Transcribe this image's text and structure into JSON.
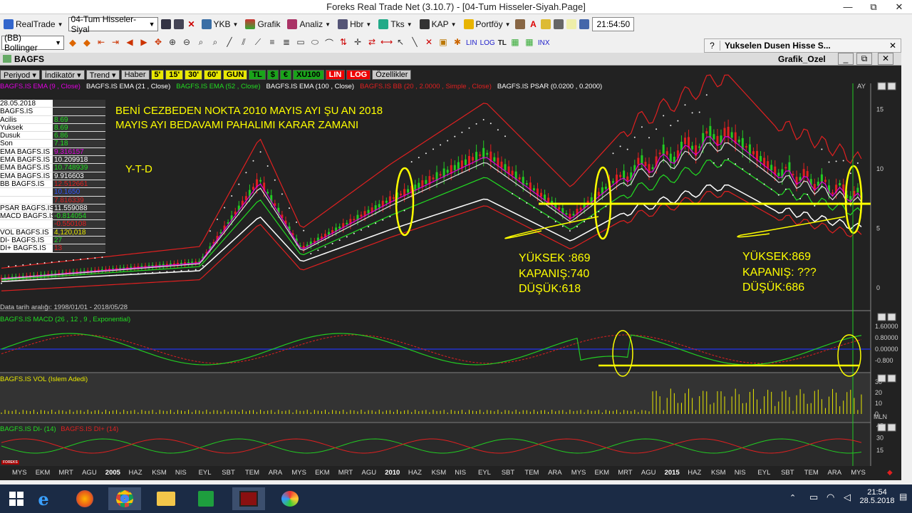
{
  "window": {
    "title": "Foreks Real Trade Net (3.10.7) - [04-Tum Hisseler-Siyah.Page]",
    "restore": "⧉",
    "close": "✕",
    "minimize": "—"
  },
  "toolbar1": {
    "realtrade": "RealTrade",
    "page_select": "04-Tum Hisseler-Siyal",
    "ykb": "YKB",
    "grafik": "Grafik",
    "analiz": "Analiz",
    "hbr": "Hbr",
    "tks": "Tks",
    "kap": "KAP",
    "portfoy": "Portföy",
    "clock": "21:54:50"
  },
  "toolbar2": {
    "indicator_select": "(BB) Bollinger",
    "lin": "LIN",
    "log": "LOG",
    "tl": "TL",
    "inx": "INX"
  },
  "panel": {
    "help": "?",
    "title": "Yukselen Dusen Hisse S..."
  },
  "chart_window": {
    "symbol": "BAGFS",
    "name": "Grafik_Ozel"
  },
  "chart_buttons": [
    "Periyod",
    "İndikatör",
    "Trend",
    "Haber",
    "5'",
    "15'",
    "30'",
    "60'",
    "GUN",
    "TL",
    "$",
    "€",
    "XU100",
    "LIN",
    "LOG",
    "Özellikler"
  ],
  "legend": [
    {
      "text": "BAGFS.IS EMA (9 , Close)",
      "color": "#e000e0"
    },
    {
      "text": "BAGFS.IS EMA (21 , Close)",
      "color": "#ffffff"
    },
    {
      "text": "BAGFS.IS EMA (52 , Close)",
      "color": "#22dd22"
    },
    {
      "text": "BAGFS.IS EMA (100 , Close)",
      "color": "#ffffff"
    },
    {
      "text": "BAGFS.IS BB (20 , 2.0000 , Simple , Close)",
      "color": "#e02020"
    },
    {
      "text": "BAGFS.IS PSAR (0.0200 , 0.2000)",
      "color": "#ffffff"
    }
  ],
  "ay_label": "AY",
  "info_table": [
    {
      "k": "28.05.2018",
      "v": "",
      "c": "#000"
    },
    {
      "k": "BAGFS.IS",
      "v": "",
      "c": "#000"
    },
    {
      "k": "Acilis",
      "v": "8.69",
      "c": "#22dd22"
    },
    {
      "k": "Yuksek",
      "v": "8.69",
      "c": "#22dd22"
    },
    {
      "k": "Dusuk",
      "v": "6.86",
      "c": "#22dd22"
    },
    {
      "k": "Son",
      "v": "7.18",
      "c": "#22dd22"
    },
    {
      "k": "EMA BAGFS.IS",
      "v": "9.316157",
      "c": "#e000e0"
    },
    {
      "k": "EMA BAGFS.IS",
      "v": "10.209918",
      "c": "#ffffff"
    },
    {
      "k": "EMA BAGFS.IS",
      "v": "10.748939",
      "c": "#22dd22"
    },
    {
      "k": "EMA BAGFS.IS",
      "v": "9.916603",
      "c": "#ffffff"
    },
    {
      "k": "BB BAGFS.IS",
      "v": "12.512661",
      "c": "#e02020"
    },
    {
      "k": "",
      "v": "10.1650",
      "c": "#3355ff"
    },
    {
      "k": "",
      "v": "7.816339",
      "c": "#e02020"
    },
    {
      "k": "PSAR BAGFS.IS",
      "v": "11.559088",
      "c": "#ffffff"
    },
    {
      "k": "MACD BAGFS.IS",
      "v": "-0.814054",
      "c": "#22dd22"
    },
    {
      "k": "",
      "v": "-0.550108",
      "c": "#e02020"
    },
    {
      "k": "VOL BAGFS.IS",
      "v": "4,120,018",
      "c": "#e8e800"
    },
    {
      "k": "DI- BAGFS.IS",
      "v": "27",
      "c": "#22dd22"
    },
    {
      "k": "DI+ BAGFS.IS",
      "v": "13",
      "c": "#e02020"
    }
  ],
  "annotations": {
    "headline_line1": "BENİ CEZBEDEN NOKTA 2010 MAYIS AYI ŞU AN 2018",
    "headline_line2": "MAYIS AYI  BEDAVAMI PAHALIMI KARAR ZAMANI",
    "ytd": "Y-T-D",
    "left_high": "YÜKSEK :869",
    "left_close": "KAPANIŞ:740",
    "left_low": "DÜŞÜK:618",
    "right_high": "YÜKSEK:869",
    "right_close": "KAPANIŞ: ???",
    "right_low": "DÜŞÜK:686"
  },
  "date_range": "Data tarih aralığı: 1998/01/01 - 2018/05/28",
  "sub_panels": {
    "macd": "BAGFS.IS MACD (26 , 12 , 9 , Exponential)",
    "vol": "BAGFS.IS VOL (Islem Adedi)",
    "di_minus": "BAGFS.IS DI- (14)",
    "di_plus": "BAGFS.IS DI+ (14)"
  },
  "price_axis": [
    "15",
    "10",
    "5",
    "0"
  ],
  "macd_axis": [
    "1.60000",
    "0.80000",
    "0.00000",
    "-0.800"
  ],
  "vol_axis": [
    "30",
    "20",
    "10",
    "0",
    "MLN"
  ],
  "di_axis": [
    "45",
    "30",
    "15"
  ],
  "months": [
    {
      "t": "MYS",
      "b": false
    },
    {
      "t": "EKM",
      "b": false
    },
    {
      "t": "MRT",
      "b": false
    },
    {
      "t": "AGU",
      "b": false
    },
    {
      "t": "2005",
      "b": true
    },
    {
      "t": "HAZ",
      "b": false
    },
    {
      "t": "KSM",
      "b": false
    },
    {
      "t": "NIS",
      "b": false
    },
    {
      "t": "EYL",
      "b": false
    },
    {
      "t": "SBT",
      "b": false
    },
    {
      "t": "TEM",
      "b": false
    },
    {
      "t": "ARA",
      "b": false
    },
    {
      "t": "MYS",
      "b": false
    },
    {
      "t": "EKM",
      "b": false
    },
    {
      "t": "MRT",
      "b": false
    },
    {
      "t": "AGU",
      "b": false
    },
    {
      "t": "2010",
      "b": true
    },
    {
      "t": "HAZ",
      "b": false
    },
    {
      "t": "KSM",
      "b": false
    },
    {
      "t": "NIS",
      "b": false
    },
    {
      "t": "EYL",
      "b": false
    },
    {
      "t": "SBT",
      "b": false
    },
    {
      "t": "TEM",
      "b": false
    },
    {
      "t": "ARA",
      "b": false
    },
    {
      "t": "MYS",
      "b": false
    },
    {
      "t": "EKM",
      "b": false
    },
    {
      "t": "MRT",
      "b": false
    },
    {
      "t": "AGU",
      "b": false
    },
    {
      "t": "2015",
      "b": true
    },
    {
      "t": "HAZ",
      "b": false
    },
    {
      "t": "KSM",
      "b": false
    },
    {
      "t": "NIS",
      "b": false
    },
    {
      "t": "EYL",
      "b": false
    },
    {
      "t": "SBT",
      "b": false
    },
    {
      "t": "TEM",
      "b": false
    },
    {
      "t": "ARA",
      "b": false
    },
    {
      "t": "MYS",
      "b": false
    }
  ],
  "foreks_logo": "FOREKS",
  "taskbar": {
    "time": "21:54",
    "date": "28.5.2018"
  },
  "colors": {
    "chart_bg": "#222222",
    "annotation": "#ffff00",
    "taskbar": "#1b2b45"
  }
}
